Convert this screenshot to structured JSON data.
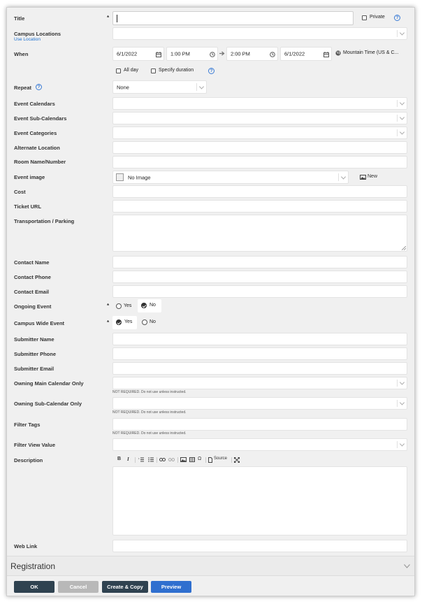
{
  "form": {
    "title": {
      "label": "Title",
      "required": "*",
      "value": "",
      "private_label": "Private"
    },
    "campus_locations": {
      "label": "Campus Locations",
      "use_location": "Use Location"
    },
    "when": {
      "label": "When",
      "start_date": "6/1/2022",
      "start_time": "1:00 PM",
      "end_time": "2:00 PM",
      "end_date": "6/1/2022",
      "timezone": "Mountain Time (US & C...",
      "all_day_label": "All day",
      "specify_duration_label": "Specify duration"
    },
    "repeat": {
      "label": "Repeat",
      "value": "None"
    },
    "event_calendars": {
      "label": "Event Calendars"
    },
    "event_sub_calendars": {
      "label": "Event Sub-Calendars"
    },
    "event_categories": {
      "label": "Event Categories"
    },
    "alternate_location": {
      "label": "Alternate Location"
    },
    "room": {
      "label": "Room Name/Number"
    },
    "event_image": {
      "label": "Event image",
      "value": "No Image",
      "new_label": "New"
    },
    "cost": {
      "label": "Cost"
    },
    "ticket_url": {
      "label": "Ticket URL"
    },
    "transportation": {
      "label": "Transportation / Parking"
    },
    "contact_name": {
      "label": "Contact Name"
    },
    "contact_phone": {
      "label": "Contact Phone"
    },
    "contact_email": {
      "label": "Contact Email"
    },
    "ongoing": {
      "label": "Ongoing Event",
      "required": "*",
      "yes": "Yes",
      "no": "No",
      "selected": "No"
    },
    "campus_wide": {
      "label": "Campus Wide Event",
      "required": "*",
      "yes": "Yes",
      "no": "No",
      "selected": "Yes"
    },
    "submitter_name": {
      "label": "Submitter Name"
    },
    "submitter_phone": {
      "label": "Submitter Phone"
    },
    "submitter_email": {
      "label": "Submitter Email"
    },
    "owning_main": {
      "label": "Owning Main Calendar Only",
      "note": "NOT REQUIRED. Do not use unless instructed."
    },
    "owning_sub": {
      "label": "Owning Sub-Calendar Only",
      "note": "NOT REQUIRED. Do not use unless instructed."
    },
    "filter_tags": {
      "label": "Filter Tags",
      "note": "NOT REQUIRED. Do not use unless instructed."
    },
    "filter_view": {
      "label": "Filter View Value"
    },
    "description": {
      "label": "Description",
      "toolbar": {
        "bold": "B",
        "italic": "I",
        "source": "Source"
      }
    },
    "web_link": {
      "label": "Web Link"
    }
  },
  "registration": {
    "label": "Registration"
  },
  "buttons": {
    "ok": "OK",
    "cancel": "Cancel",
    "create_copy": "Create & Copy",
    "preview": "Preview"
  },
  "colors": {
    "ok": "#2f4250",
    "cancel": "#b8b8b8",
    "create_copy": "#2f4250",
    "preview": "#2f6fcf",
    "link": "#1a6fd0"
  },
  "icons": [
    "calendar-icon",
    "clock-icon",
    "arrow-right-icon",
    "globe-icon",
    "help-icon",
    "chevron-down-icon",
    "image-icon",
    "resize-handle-icon"
  ]
}
